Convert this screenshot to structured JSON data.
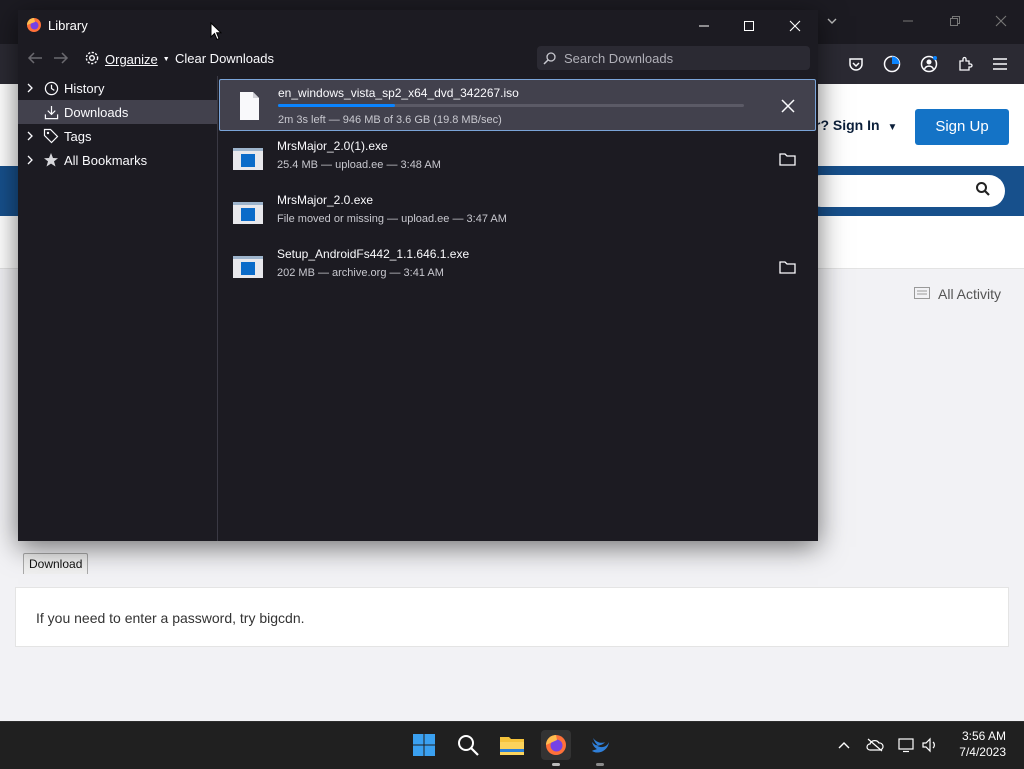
{
  "browser": {
    "header": {
      "signin_label": "r? Sign In",
      "signup_label": "Sign Up"
    },
    "activity_label": "All Activity",
    "download_tab_label": "Download",
    "info_text": "If you need to enter a password, try bigcdn."
  },
  "library": {
    "title": "Library",
    "toolbar": {
      "organize_label": "Organize",
      "clear_label": "Clear Downloads",
      "search_placeholder": "Search Downloads"
    },
    "sidebar": [
      {
        "label": "History",
        "icon": "clock-icon",
        "expandable": true
      },
      {
        "label": "Downloads",
        "icon": "download-icon",
        "expandable": false,
        "selected": true
      },
      {
        "label": "Tags",
        "icon": "tag-icon",
        "expandable": true
      },
      {
        "label": "All Bookmarks",
        "icon": "star-icon",
        "expandable": true
      }
    ],
    "downloads": [
      {
        "name": "en_windows_vista_sp2_x64_dvd_342267.iso",
        "status": "2m 3s left — 946 MB of 3.6 GB (19.8 MB/sec)",
        "progress": 0.25,
        "active": true,
        "action": "cancel-icon"
      },
      {
        "name": "MrsMajor_2.0(1).exe",
        "status": "25.4 MB — upload.ee — 3:48 AM",
        "action": "folder-icon"
      },
      {
        "name": "MrsMajor_2.0.exe",
        "status": "File moved or missing — upload.ee — 3:47 AM",
        "action": ""
      },
      {
        "name": "Setup_AndroidFs442_1.1.646.1.exe",
        "status": "202 MB — archive.org — 3:41 AM",
        "action": "folder-icon"
      }
    ]
  },
  "taskbar": {
    "apps": [
      "windows-start-icon",
      "search-icon",
      "file-explorer-icon",
      "firefox-icon",
      "swift-app-icon"
    ],
    "time": "3:56 AM",
    "date": "7/4/2023"
  },
  "colors": {
    "accent": "#0a84ff",
    "signup": "#1473c6",
    "nav": "#17508c"
  }
}
